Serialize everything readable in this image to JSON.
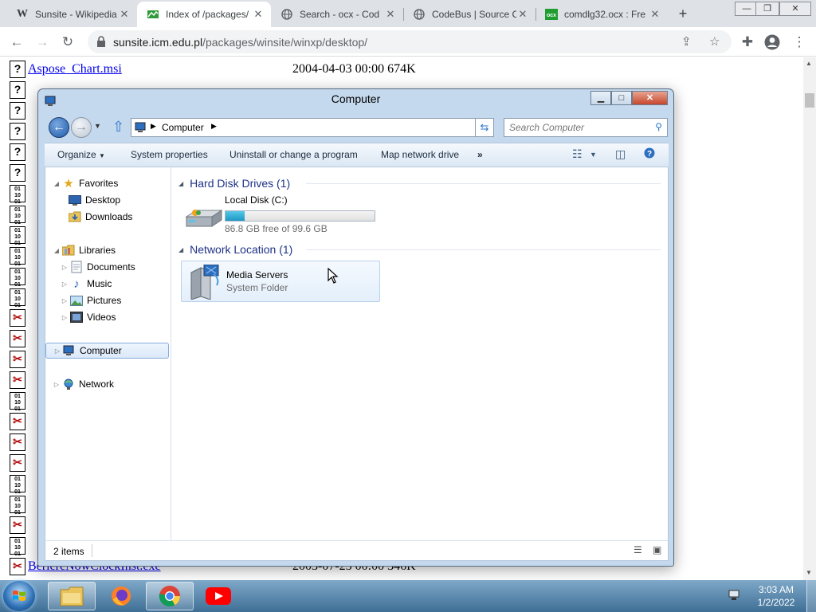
{
  "browser": {
    "tabs": [
      {
        "title": "Sunsite - Wikipedia",
        "favicon": "wikipedia-icon"
      },
      {
        "title": "Index of /packages/",
        "favicon": "sunsite-icon"
      },
      {
        "title": "Search - ocx - Cod",
        "favicon": "globe-icon"
      },
      {
        "title": "CodeBus | Source C",
        "favicon": "globe-icon"
      },
      {
        "title": "comdlg32.ocx : Fre",
        "favicon": "ocx-icon"
      }
    ],
    "active_tab": 1,
    "url_host": "sunsite.icm.edu.pl",
    "url_path": "/packages/winsite/winxp/desktop/"
  },
  "page": {
    "visible_rows": [
      {
        "name": "Aspose_Chart.msi",
        "meta": "2004-04-03 00:00  674K",
        "icon": "unknown-file-icon"
      },
      {
        "name": "BerlereNowClockInst.exe",
        "meta": "2003-07-25 00:00  346K",
        "icon": "exe-icon"
      }
    ],
    "hidden_rows_count": 23
  },
  "explorer": {
    "title": "Computer",
    "address_crumb": "Computer",
    "search_placeholder": "Search Computer",
    "commands": {
      "organize": "Organize",
      "system_properties": "System properties",
      "uninstall": "Uninstall or change a program",
      "map_drive": "Map network drive",
      "more": "»"
    },
    "nav": {
      "favorites": "Favorites",
      "desktop": "Desktop",
      "downloads": "Downloads",
      "libraries": "Libraries",
      "documents": "Documents",
      "music": "Music",
      "pictures": "Pictures",
      "videos": "Videos",
      "computer": "Computer",
      "network": "Network"
    },
    "groups": {
      "hard_disk": "Hard Disk Drives (1)",
      "network": "Network Location (1)"
    },
    "drive": {
      "name": "Local Disk (C:)",
      "free_text": "86.8 GB free of 99.6 GB",
      "used_fraction": 0.129
    },
    "network_item": {
      "name": "Media Servers",
      "type": "System Folder"
    },
    "status": "2 items"
  },
  "taskbar": {
    "time": "3:03 AM",
    "date": "1/2/2022",
    "pinned": [
      "explorer-icon",
      "firefox-icon",
      "chrome-icon",
      "youtube-icon"
    ]
  }
}
